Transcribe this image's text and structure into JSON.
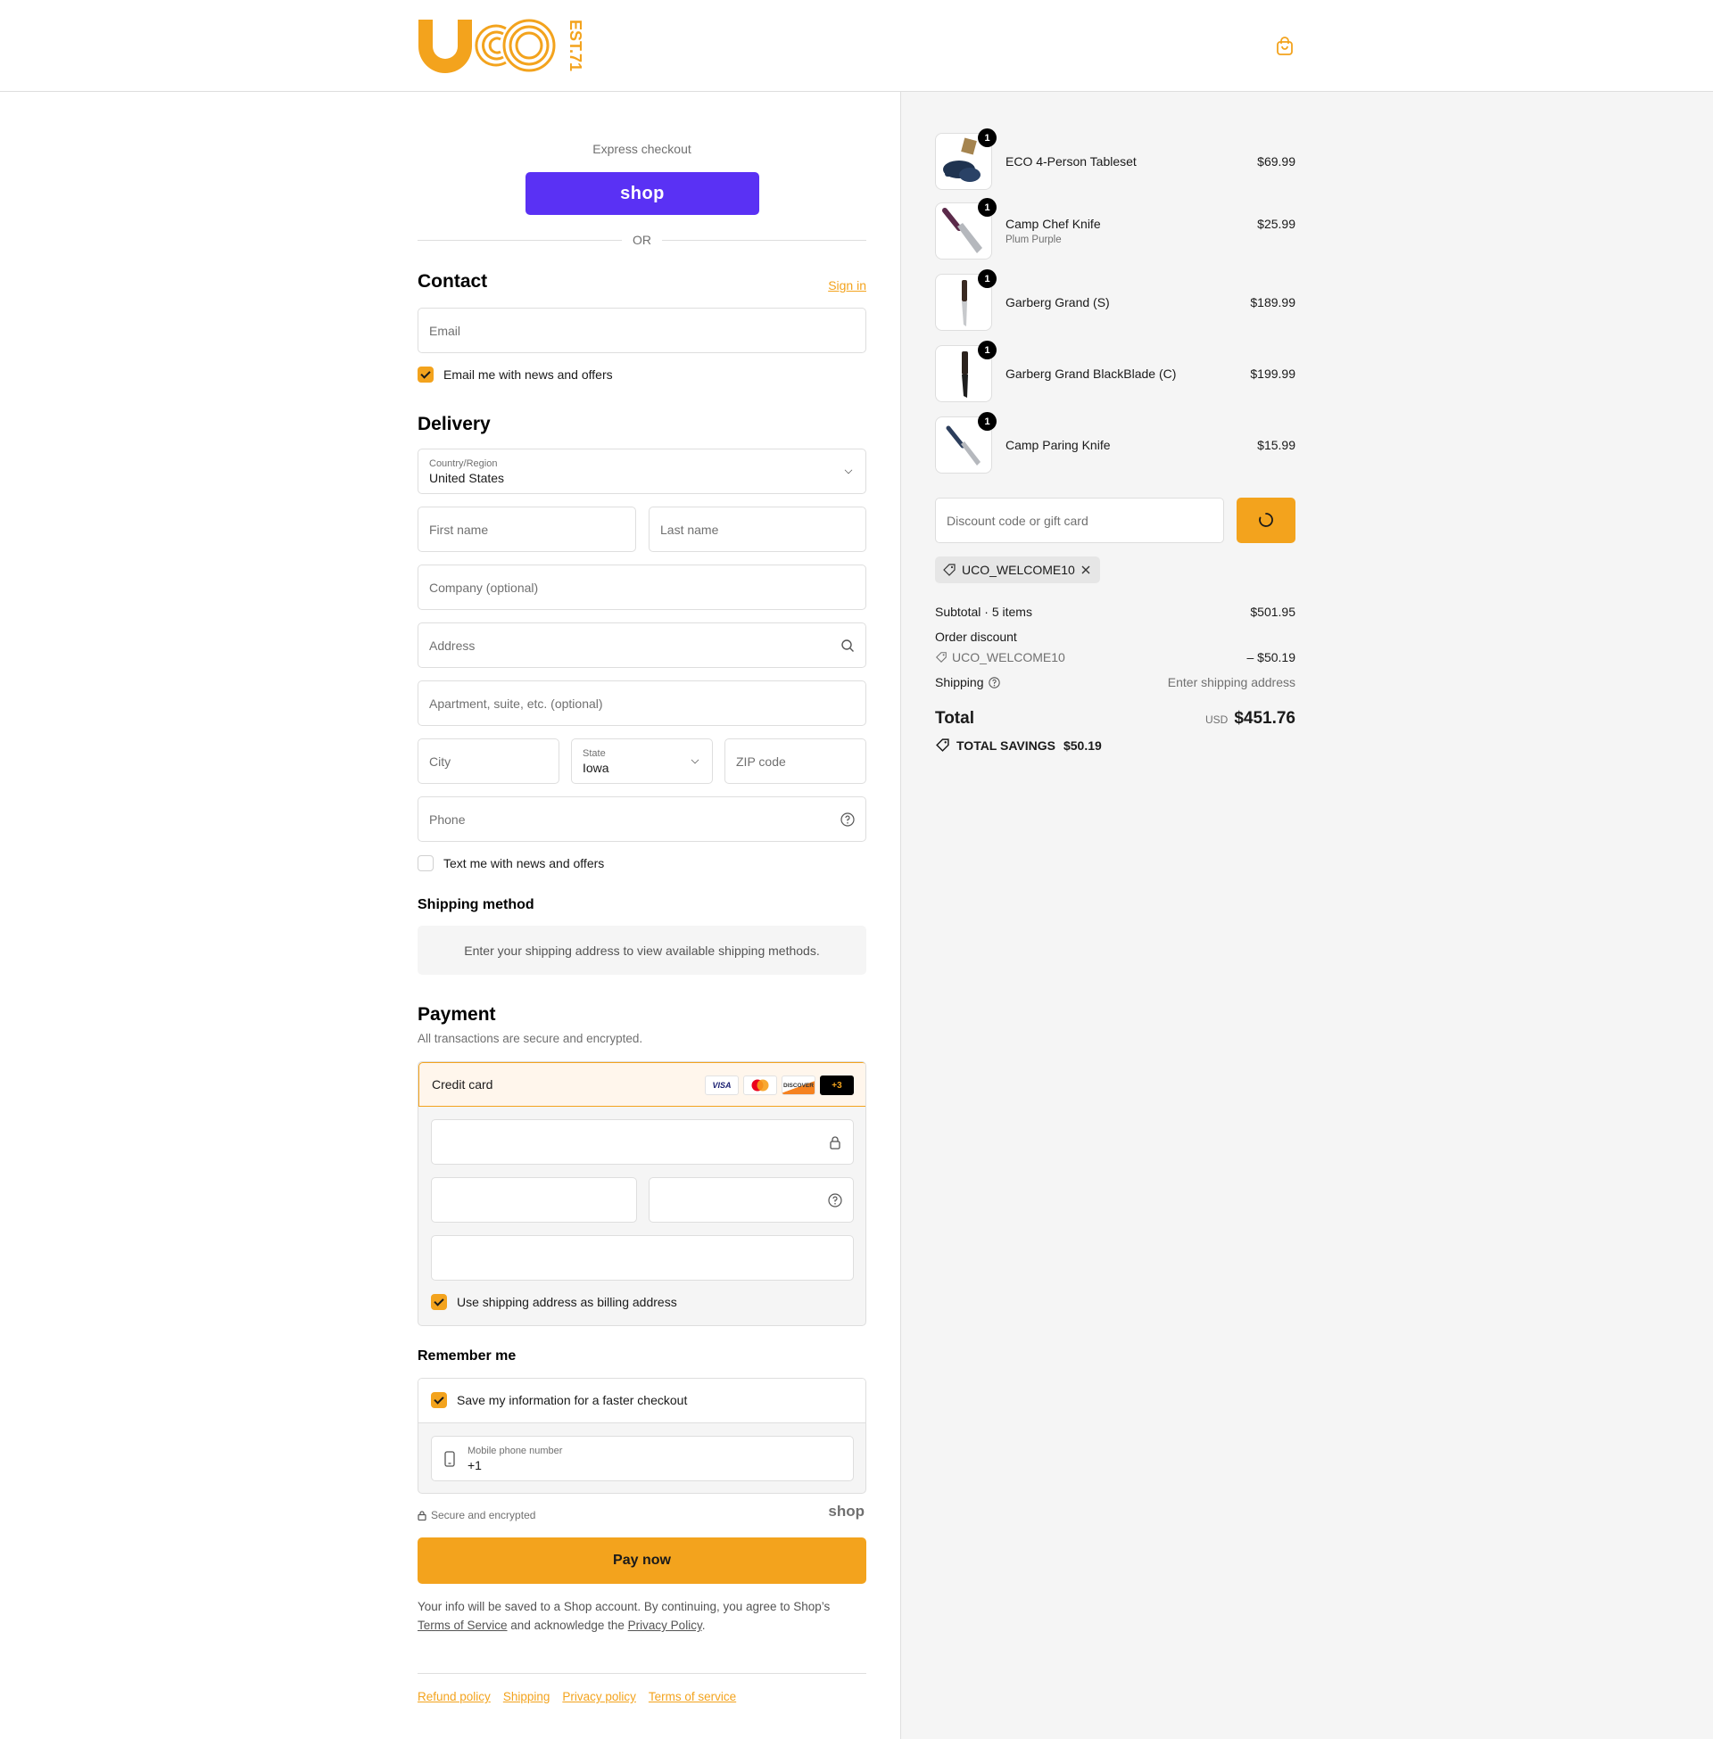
{
  "brand": {
    "logo_text": "UCO",
    "logo_sub": "EST.71",
    "accent": "#f3a31d",
    "shop_color": "#5a31f4"
  },
  "header": {
    "cart_icon": "bag-icon"
  },
  "express": {
    "label": "Express checkout",
    "shop_button": "shop",
    "or": "OR"
  },
  "contact": {
    "title": "Contact",
    "sign_in": "Sign in",
    "email_placeholder": "Email",
    "news_label": "Email me with news and offers",
    "news_checked": true
  },
  "delivery": {
    "title": "Delivery",
    "country_label": "Country/Region",
    "country_value": "United States",
    "first_name": "First name",
    "last_name": "Last name",
    "company": "Company (optional)",
    "address": "Address",
    "apartment": "Apartment, suite, etc. (optional)",
    "city": "City",
    "state_label": "State",
    "state_value": "Iowa",
    "zip": "ZIP code",
    "phone": "Phone",
    "text_label": "Text me with news and offers",
    "text_checked": false
  },
  "shipping_method": {
    "title": "Shipping method",
    "note": "Enter your shipping address to view available shipping methods."
  },
  "payment": {
    "title": "Payment",
    "subtitle": "All transactions are secure and encrypted.",
    "method": "Credit card",
    "cards": [
      "VISA",
      "MC",
      "DISCOVER",
      "+3"
    ],
    "billing_label": "Use shipping address as billing address",
    "billing_checked": true
  },
  "remember": {
    "title": "Remember me",
    "save_label": "Save my information for a faster checkout",
    "save_checked": true,
    "phone_label": "Mobile phone number",
    "phone_value": "+1",
    "secure": "Secure and encrypted",
    "shop_mark": "shop"
  },
  "pay_now": "Pay now",
  "legal": {
    "text1": "Your info will be saved to a Shop account. By continuing, you agree to Shop’s",
    "tos": "Terms of Service",
    "text2": "and acknowledge the",
    "privacy": "Privacy Policy",
    "end": "."
  },
  "footer": [
    "Refund policy",
    "Shipping",
    "Privacy policy",
    "Terms of service"
  ],
  "order": {
    "items": [
      {
        "name": "ECO 4-Person Tableset",
        "variant": "",
        "price": "$69.99",
        "qty": "1"
      },
      {
        "name": "Camp Chef Knife",
        "variant": "Plum Purple",
        "price": "$25.99",
        "qty": "1"
      },
      {
        "name": "Garberg Grand (S)",
        "variant": "",
        "price": "$189.99",
        "qty": "1"
      },
      {
        "name": "Garberg Grand BlackBlade (C)",
        "variant": "",
        "price": "$199.99",
        "qty": "1"
      },
      {
        "name": "Camp Paring Knife",
        "variant": "",
        "price": "$15.99",
        "qty": "1"
      }
    ],
    "discount_placeholder": "Discount code or gift card",
    "applied_code": "UCO_WELCOME10",
    "subtotal_label": "Subtotal · 5 items",
    "subtotal": "$501.95",
    "order_discount_label": "Order discount",
    "discount_code": "UCO_WELCOME10",
    "discount_amount": "– $50.19",
    "shipping_label": "Shipping",
    "shipping_value": "Enter shipping address",
    "total_label": "Total",
    "currency": "USD",
    "total": "$451.76",
    "savings_label": "TOTAL SAVINGS",
    "savings": "$50.19"
  }
}
